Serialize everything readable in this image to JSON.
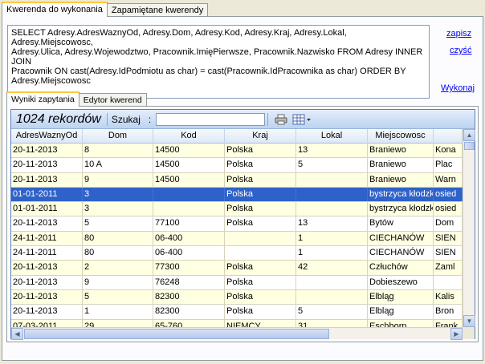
{
  "top_tabs": [
    "Kwerenda do wykonania",
    "Zapamiętane kwerendy"
  ],
  "query_text": "SELECT Adresy.AdresWaznyOd, Adresy.Dom, Adresy.Kod, Adresy.Kraj, Adresy.Lokal, Adresy.Miejscowosc,\nAdresy.Ulica, Adresy.Wojewodztwo, Pracownik.ImięPierwsze, Pracownik.Nazwisko FROM Adresy INNER JOIN\nPracownik ON cast(Adresy.IdPodmiotu as char) = cast(Pracownik.IdPracownika as char) ORDER BY\nAdresy.Miejscowosc",
  "links": {
    "save": "zapisz",
    "clear": "czyść",
    "run": "Wykonaj"
  },
  "result_tabs": [
    "Wyniki zapytania",
    "Edytor kwerend"
  ],
  "toolbar": {
    "count": "1024 rekordów",
    "search_label": "Szukaj",
    "search_colon": ":",
    "search_value": ""
  },
  "columns": [
    "AdresWaznyOd",
    "Dom",
    "Kod",
    "Kraj",
    "Lokal",
    "Miejscowosc",
    ""
  ],
  "rows": [
    [
      "20-11-2013",
      "8",
      "14500",
      "Polska",
      "13",
      "Braniewo",
      "Kona"
    ],
    [
      "20-11-2013",
      "10 A",
      "14500",
      "Polska",
      "5",
      "Braniewo",
      "Plac"
    ],
    [
      "20-11-2013",
      "9",
      "14500",
      "Polska",
      "",
      "Braniewo",
      "Warn"
    ],
    [
      "01-01-2011",
      "3",
      "",
      "Polska",
      "",
      "bystrzyca kłodzka",
      "osied"
    ],
    [
      "01-01-2011",
      "3",
      "",
      "Polska",
      "",
      "bystrzyca kłodzka",
      "osied"
    ],
    [
      "20-11-2013",
      "5",
      "77100",
      "Polska",
      "13",
      "Bytów",
      "Dom"
    ],
    [
      "24-11-2011",
      "80",
      "06-400",
      "",
      "1",
      "CIECHANÓW",
      "SIEN"
    ],
    [
      "24-11-2011",
      "80",
      "06-400",
      "",
      "1",
      "CIECHANÓW",
      "SIEN"
    ],
    [
      "20-11-2013",
      "2",
      "77300",
      "Polska",
      "42",
      "Człuchów",
      "Zaml"
    ],
    [
      "20-11-2013",
      "9",
      "76248",
      "Polska",
      "",
      "Dobieszewo",
      ""
    ],
    [
      "20-11-2013",
      "5",
      "82300",
      "Polska",
      "",
      "Elbląg",
      "Kalis"
    ],
    [
      "20-11-2013",
      "1",
      "82300",
      "Polska",
      "5",
      "Elbląg",
      "Bron"
    ],
    [
      "07-03-2011",
      "29",
      "65-760",
      "NIEMCY",
      "31",
      "Eschborn",
      "Frank"
    ]
  ],
  "selected_row": 3
}
